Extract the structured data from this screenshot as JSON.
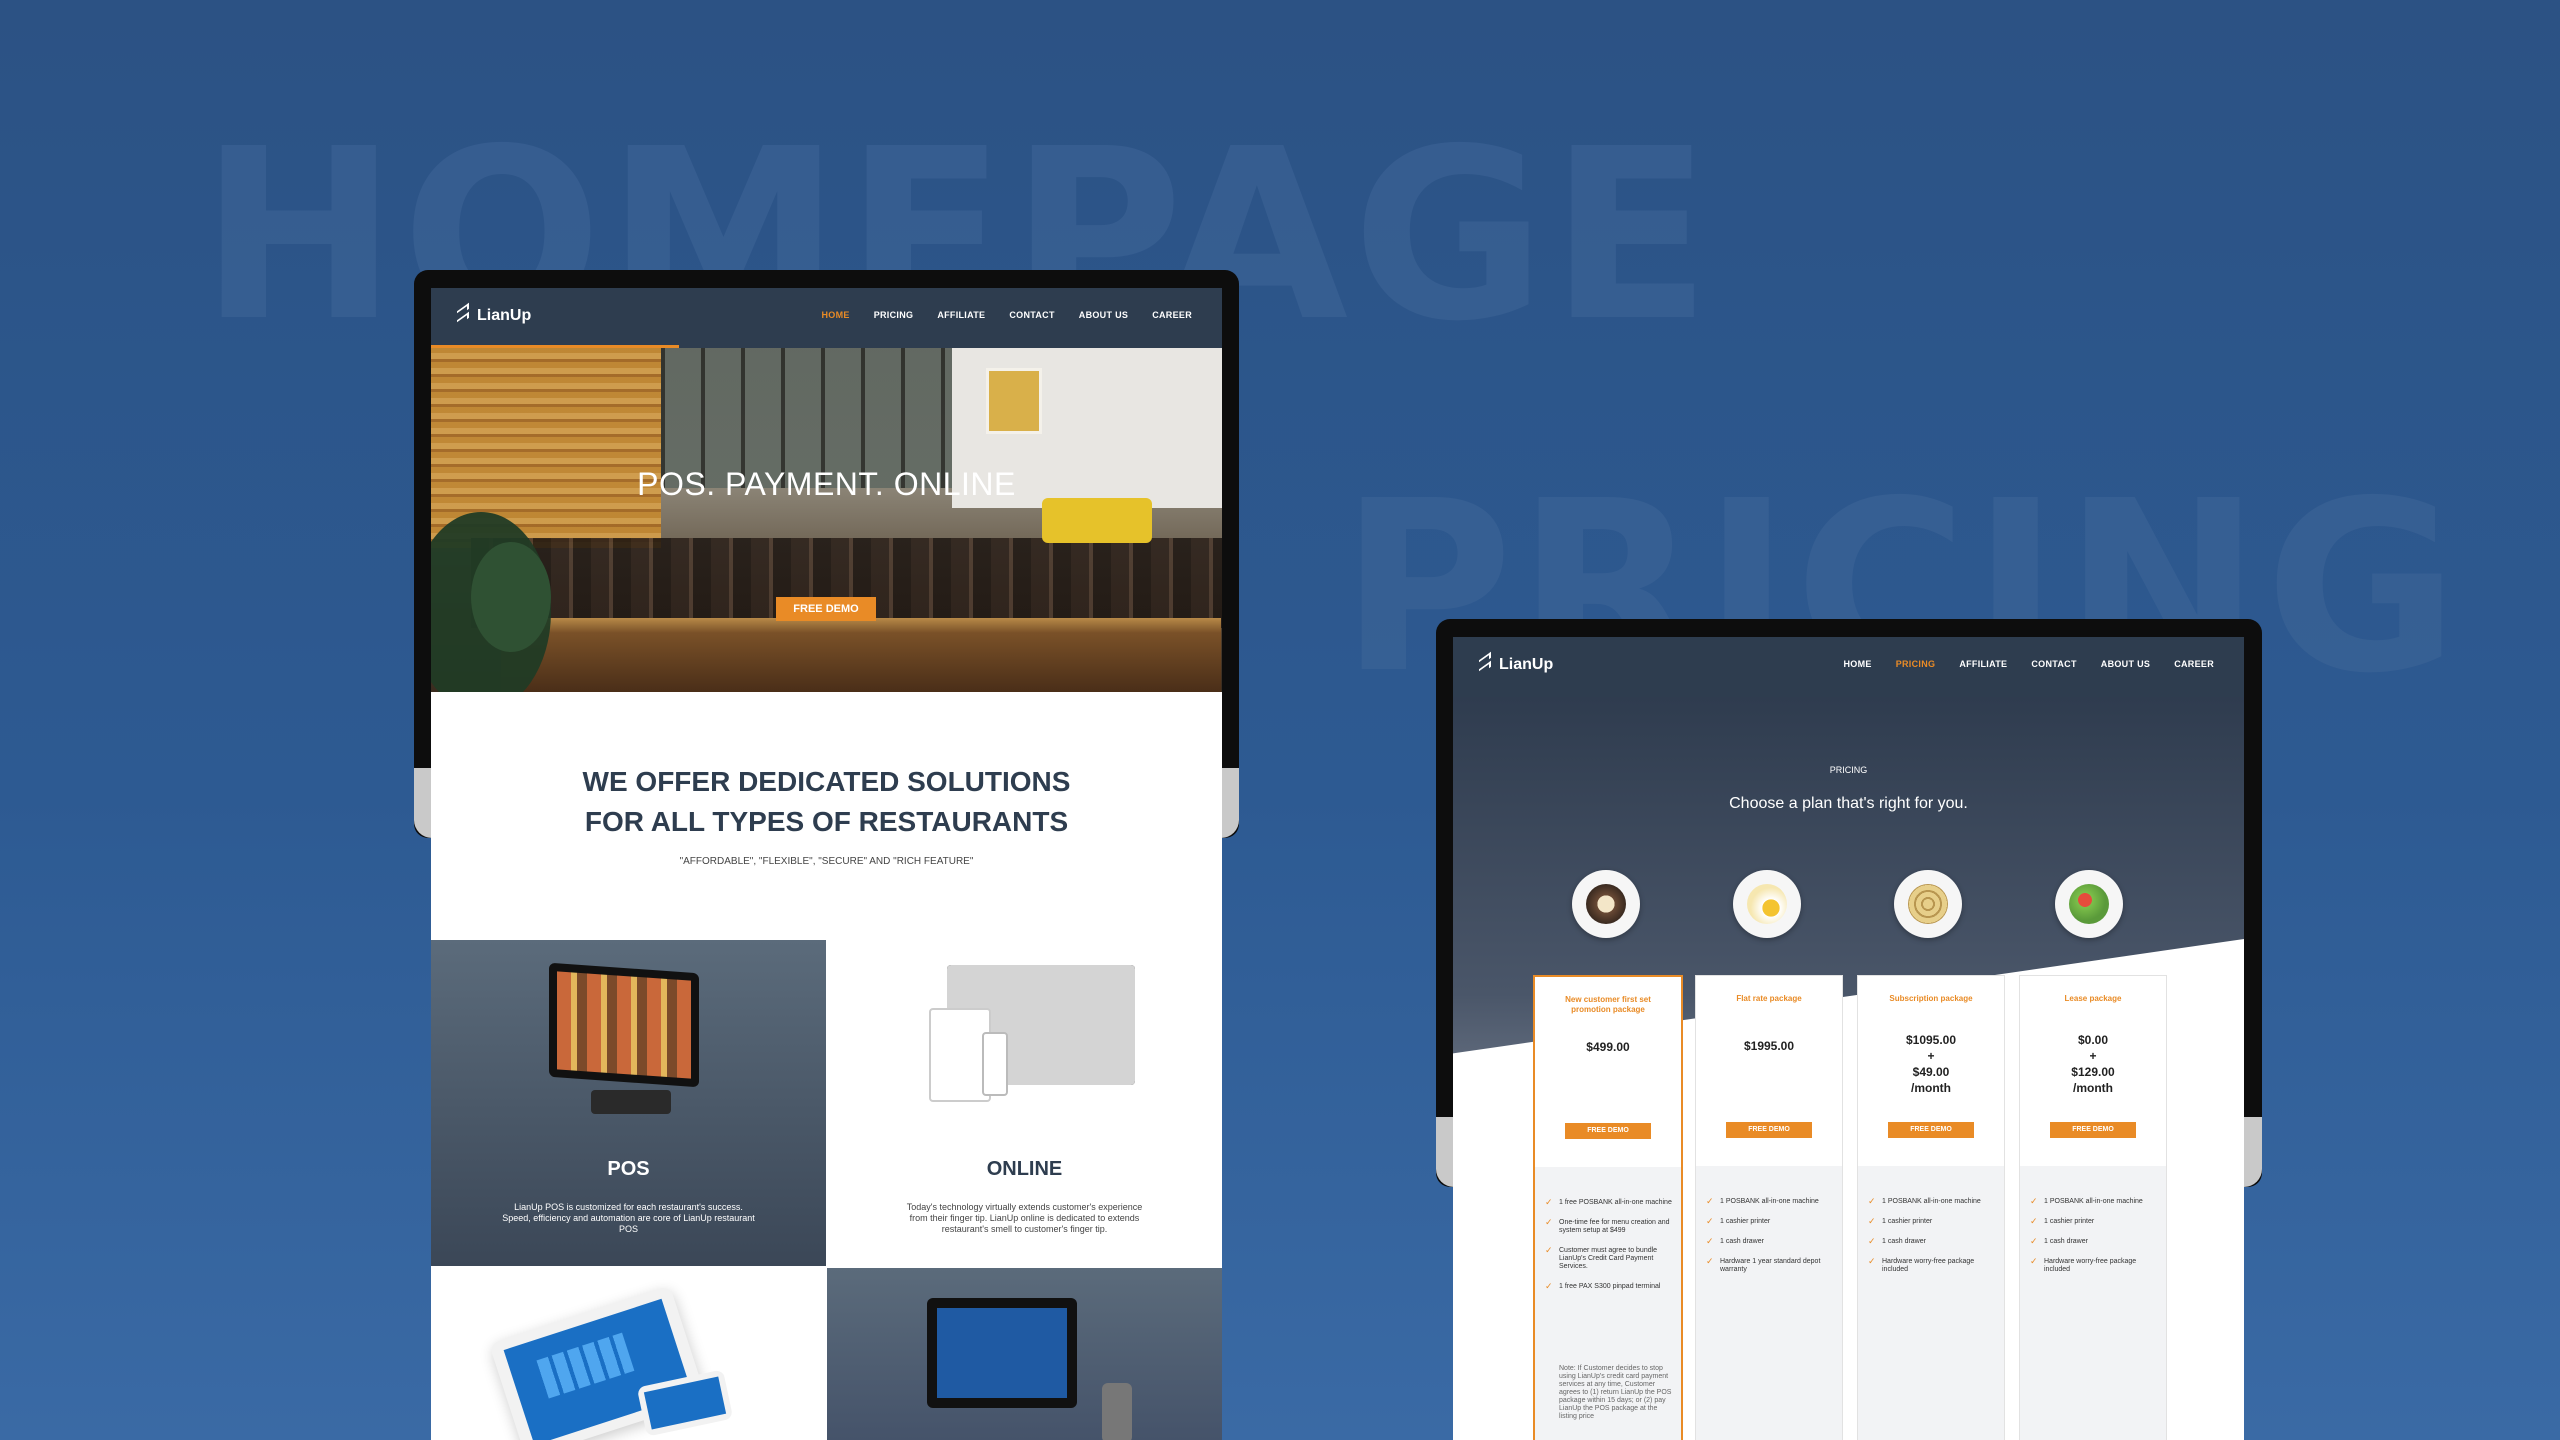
{
  "background_labels": {
    "homepage": "HOMEPAGE",
    "pricing": "PRICING"
  },
  "colors": {
    "accent": "#e98b26",
    "nav_bg": "#2e3d4f",
    "page_bg": "#2c5284"
  },
  "homepage": {
    "logo": "LianUp",
    "nav": [
      "HOME",
      "PRICING",
      "AFFILIATE",
      "CONTACT",
      "ABOUT US",
      "CAREER"
    ],
    "active_nav": "HOME",
    "hero_title": "POS. PAYMENT. ONLINE",
    "hero_button": "FREE DEMO",
    "solutions_title_line1": "WE OFFER DEDICATED SOLUTIONS",
    "solutions_title_line2": "FOR ALL TYPES OF RESTAURANTS",
    "solutions_subtitle": "\"AFFORDABLE\", \"FLEXIBLE\", \"SECURE\" AND \"RICH FEATURE\"",
    "tiles": [
      {
        "title": "POS",
        "text": "LianUp POS is customized for each restaurant's success. Speed, efficiency and automation are core of LianUp restaurant POS"
      },
      {
        "title": "ONLINE",
        "text": "Today's technology virtually extends customer's experience from their finger tip. LianUp online is dedicated to extends restaurant's smell to customer's finger tip."
      }
    ]
  },
  "pricing_page": {
    "logo": "LianUp",
    "nav": [
      "HOME",
      "PRICING",
      "AFFILIATE",
      "CONTACT",
      "ABOUT US",
      "CAREER"
    ],
    "active_nav": "PRICING",
    "section_label": "PRICING",
    "title": "Choose a plan that's right for you.",
    "plans": [
      {
        "name": "New customer first set promotion package",
        "price": "$499.00",
        "button": "FREE DEMO",
        "features": [
          "1 free POSBANK all-in-one machine",
          "One-time fee for menu creation and system setup at $499",
          "Customer must agree to bundle LianUp's Credit Card Payment Services.",
          "1 free PAX S300 pinpad terminal"
        ],
        "note": "Note: If Customer decides to stop using LianUp's credit card payment services at any time, Customer agrees to (1) return LianUp the POS package within 15 days; or (2) pay LianUp the POS package at the listing price"
      },
      {
        "name": "Flat rate package",
        "price": "$1995.00",
        "button": "FREE DEMO",
        "features": [
          "1 POSBANK all-in-one machine",
          "1 cashier printer",
          "1 cash drawer",
          "Hardware 1 year standard depot warranty"
        ]
      },
      {
        "name": "Subscription package",
        "price_line1": "$1095.00",
        "price_line2": "+",
        "price_line3": "$49.00",
        "price_line4": "/month",
        "button": "FREE DEMO",
        "features": [
          "1 POSBANK all-in-one machine",
          "1 cashier printer",
          "1 cash drawer",
          "Hardware worry-free package included"
        ]
      },
      {
        "name": "Lease package",
        "price_line1": "$0.00",
        "price_line2": "+",
        "price_line3": "$129.00",
        "price_line4": "/month",
        "button": "FREE DEMO",
        "features": [
          "1 POSBANK all-in-one machine",
          "1 cashier printer",
          "1 cash drawer",
          "Hardware worry-free package included"
        ]
      }
    ]
  }
}
